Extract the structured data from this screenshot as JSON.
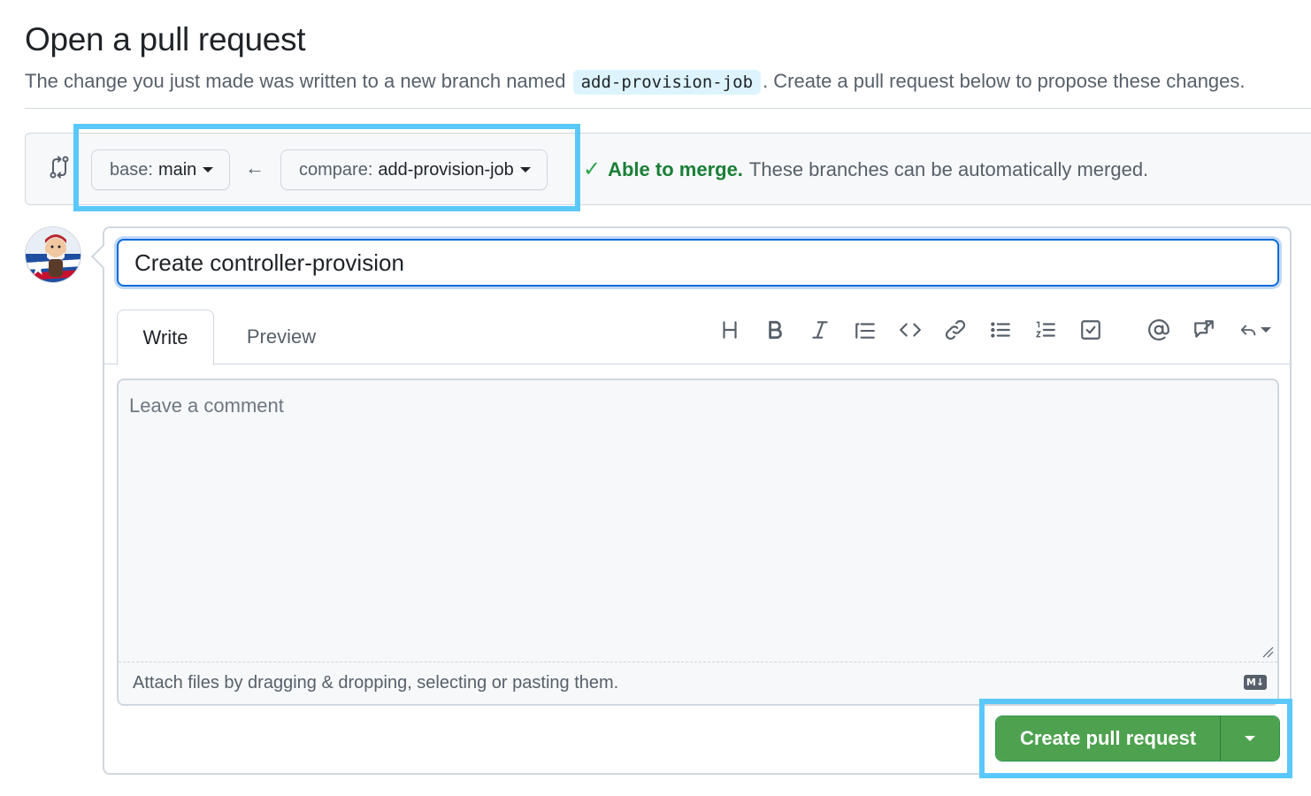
{
  "page": {
    "title": "Open a pull request",
    "subtitle_before": "The change you just made was written to a new branch named",
    "branch_code": "add-provision-job",
    "subtitle_after": ". Create a pull request below to propose these changes."
  },
  "range": {
    "base_label": "base:",
    "base_value": "main",
    "compare_label": "compare:",
    "compare_value": "add-provision-job",
    "arrow": "←",
    "merge_check": "✓",
    "merge_ok": "Able to merge.",
    "merge_desc": "These branches can be automatically merged."
  },
  "form": {
    "title_value": "Create controller-provision",
    "tabs": [
      {
        "label": "Write",
        "selected": true
      },
      {
        "label": "Preview",
        "selected": false
      }
    ],
    "toolbar_icons": [
      "heading-icon",
      "bold-icon",
      "italic-icon",
      "quote-icon",
      "code-icon",
      "link-icon",
      "unordered-list-icon",
      "ordered-list-icon",
      "task-list-icon",
      "mention-icon",
      "cross-reference-icon",
      "saved-replies-icon"
    ],
    "comment_placeholder": "Leave a comment",
    "attach_text": "Attach files by dragging & dropping, selecting or pasting them.",
    "md_badge": "M↓",
    "submit_label": "Create pull request"
  },
  "colors": {
    "accent_blue": "#0969da",
    "highlight": "#5ac8fa",
    "success_green": "#1a7f37",
    "button_green": "#4ea24f"
  }
}
